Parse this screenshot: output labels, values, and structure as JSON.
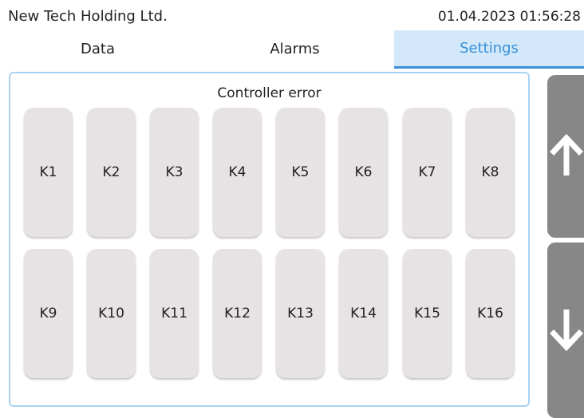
{
  "header": {
    "company": "New Tech Holding Ltd.",
    "datetime": "01.04.2023 01:56:28"
  },
  "tabs": [
    {
      "label": "Data",
      "active": false
    },
    {
      "label": "Alarms",
      "active": false
    },
    {
      "label": "Settings",
      "active": true
    }
  ],
  "panel": {
    "title": "Controller error",
    "buttons": [
      "K1",
      "K2",
      "K3",
      "K4",
      "K5",
      "K6",
      "K7",
      "K8",
      "K9",
      "K10",
      "K11",
      "K12",
      "K13",
      "K14",
      "K15",
      "K16"
    ]
  },
  "side_nav": {
    "up_icon": "arrow-up-icon",
    "down_icon": "arrow-down-icon"
  },
  "colors": {
    "active_tab_bg": "#d3e9fb",
    "active_tab_text": "#3a8fd8",
    "panel_border": "#a8d2f2",
    "button_bg": "#e7e3e4",
    "side_button_bg": "#878787"
  }
}
